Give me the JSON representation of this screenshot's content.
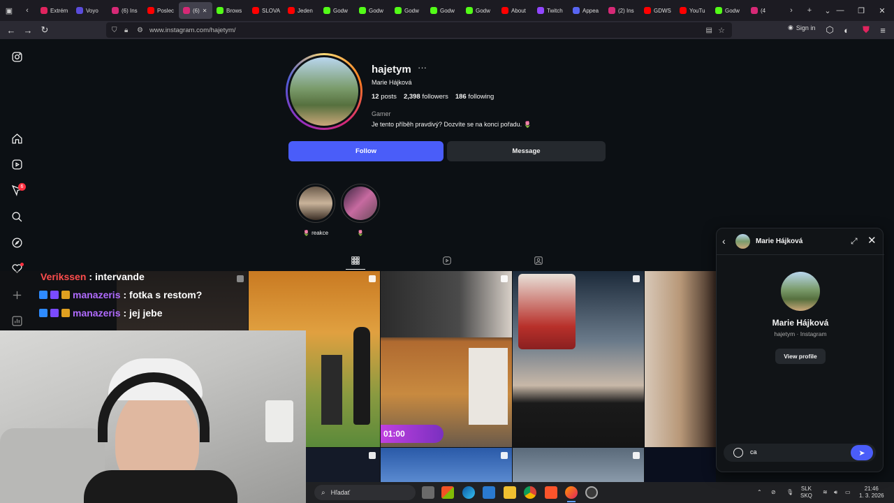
{
  "browser": {
    "tabs": [
      {
        "label": "Extrém",
        "color": "#e0245e"
      },
      {
        "label": "Voyo",
        "color": "#5a4cdb"
      },
      {
        "label": "(6) Ins",
        "color": "#d62976"
      },
      {
        "label": "Poslec",
        "color": "#ff0000"
      },
      {
        "label": "(6)",
        "color": "#d62976"
      },
      {
        "label": "Brows",
        "color": "#53fc18"
      },
      {
        "label": "SLOVA",
        "color": "#ff0000"
      },
      {
        "label": "Jeden",
        "color": "#ff0000"
      },
      {
        "label": "Godw",
        "color": "#53fc18"
      },
      {
        "label": "Godw",
        "color": "#53fc18"
      },
      {
        "label": "Godw",
        "color": "#53fc18"
      },
      {
        "label": "Godw",
        "color": "#53fc18"
      },
      {
        "label": "Godw",
        "color": "#53fc18"
      },
      {
        "label": "About",
        "color": "#ff0000"
      },
      {
        "label": "Twitch",
        "color": "#9146ff"
      },
      {
        "label": "Appea",
        "color": "#5865f2"
      },
      {
        "label": "(2) Ins",
        "color": "#d62976"
      },
      {
        "label": "GDWS",
        "color": "#ff0000"
      },
      {
        "label": "YouTu",
        "color": "#ff0000"
      },
      {
        "label": "Godw",
        "color": "#53fc18"
      },
      {
        "label": "(4",
        "color": "#d62976"
      }
    ],
    "url": "www.instagram.com/hajetym/",
    "sign_in": "Sign in"
  },
  "profile": {
    "username": "hajetym",
    "more": "···",
    "full_name": "Marie Hájková",
    "posts_count": "12",
    "posts_label": "posts",
    "followers_count": "2,398",
    "followers_label": "followers",
    "following_count": "186",
    "following_label": "following",
    "category": "Gamer",
    "bio": "Je tento příběh pravdivý? Dozvíte se na konci pořadu. 🌷",
    "follow_label": "Follow",
    "message_label": "Message",
    "highlights": [
      {
        "label": "🌷 reakce"
      },
      {
        "label": "🌷"
      }
    ],
    "nav_badge": "6"
  },
  "stream_chat": [
    {
      "user": "Verikssen",
      "text": ": intervande"
    },
    {
      "user": "manazeris",
      "text": ": fotka s restom?"
    },
    {
      "user": "manazeris",
      "text": ": jej jebe"
    }
  ],
  "post_overlay_text": "01:00",
  "dm": {
    "name": "Marie Hájková",
    "subtitle": "hajetym · Instagram",
    "view_profile": "View profile",
    "input_value": "ca"
  },
  "taskbar": {
    "search_placeholder": "Hľadať",
    "lang_top": "SLK",
    "lang_bottom": "SKQ",
    "time": "21:46",
    "date": "1. 3. 2026"
  }
}
